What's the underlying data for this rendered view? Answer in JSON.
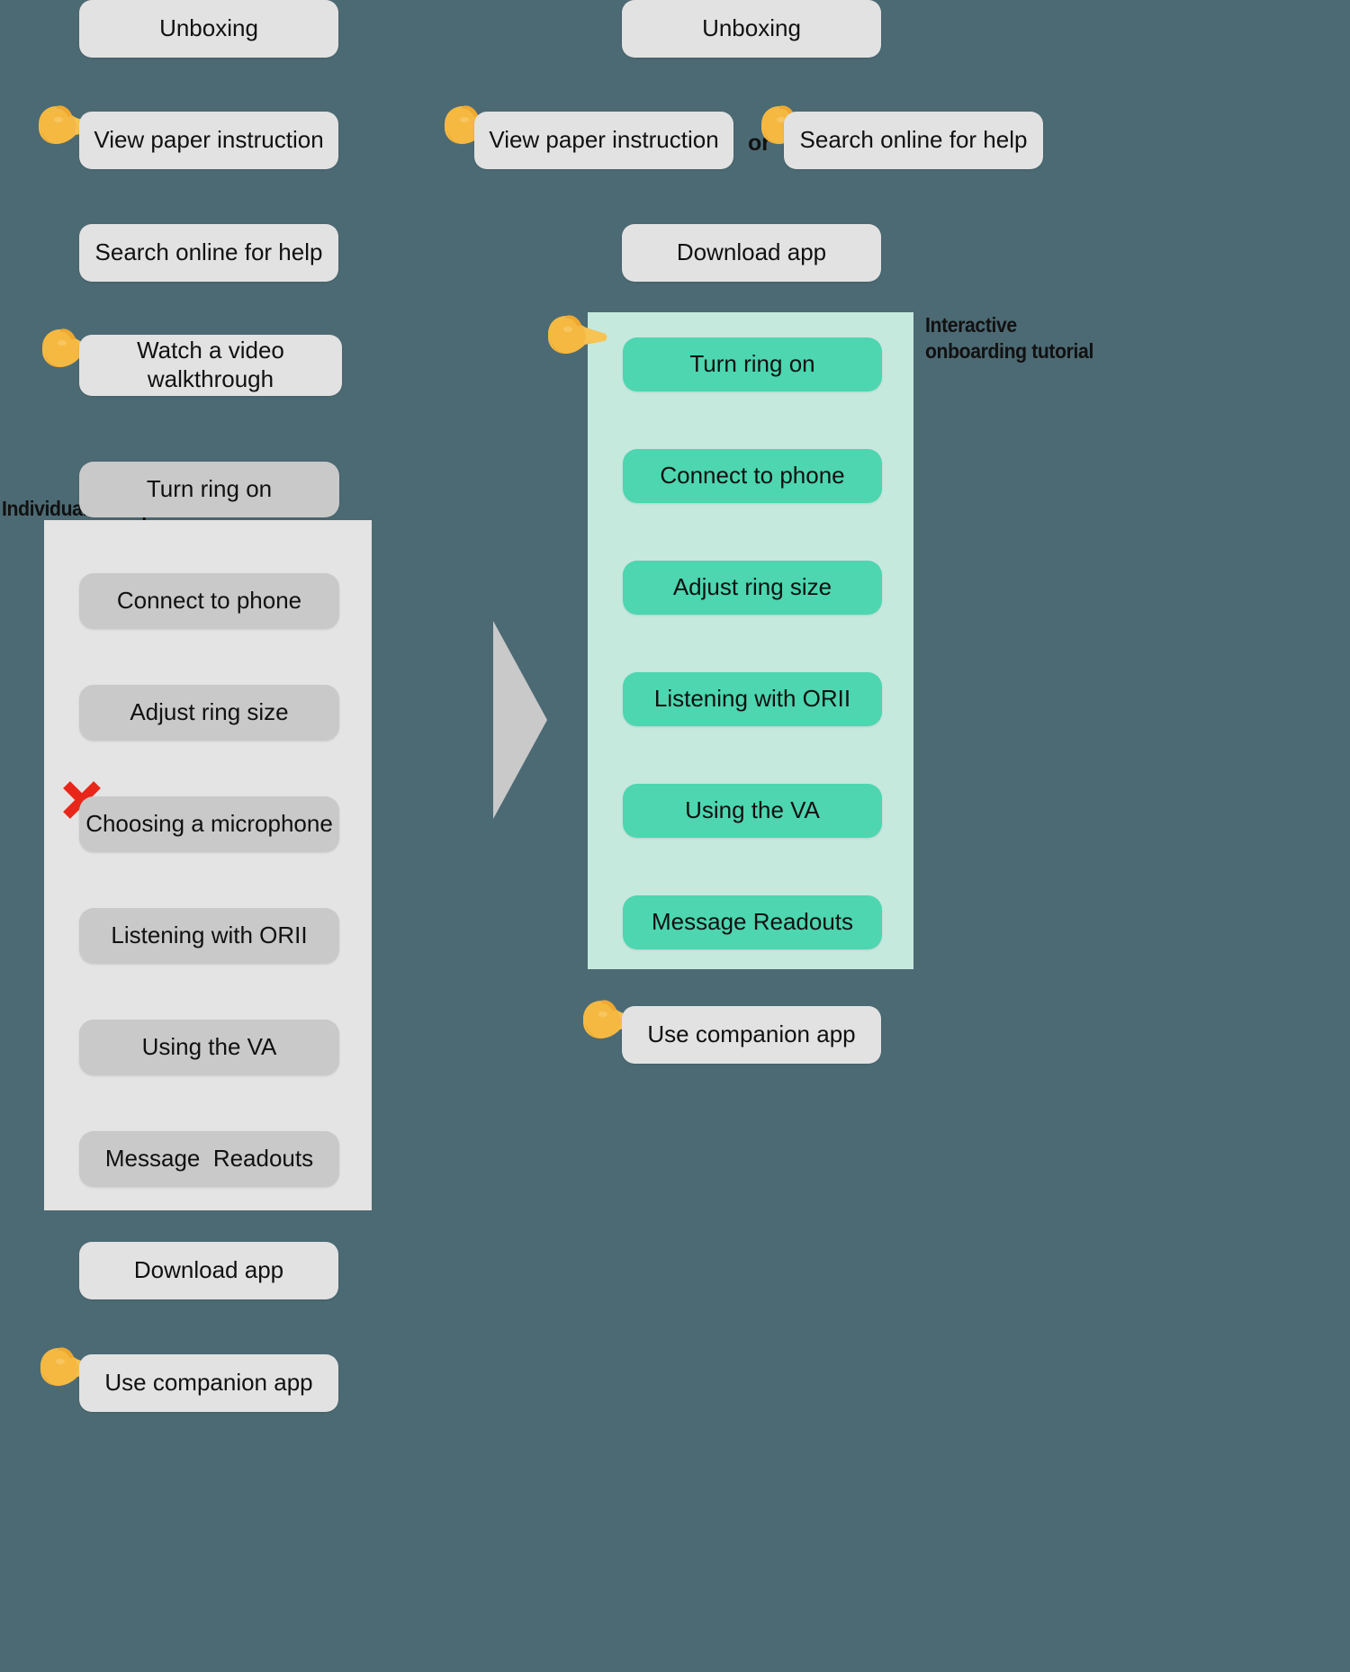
{
  "theme": {
    "background_color": "#4c6a73",
    "pill_color": "#e2e2e2",
    "grey_panel_color": "#e4e4e4",
    "grey_step_color": "#c9c9c9",
    "mint_panel_color": "#c6e9de",
    "mint_step_color": "#4dd6b0",
    "arrow_color": "#c9c9c9",
    "x_mark_color": "#e8271a",
    "text_color": "#111111"
  },
  "left_column": {
    "annotation": "Individual attempt",
    "steps_before": [
      {
        "label": "Unboxing",
        "has_hand": false
      },
      {
        "label": "View paper instruction",
        "has_hand": true
      },
      {
        "label": "Search online for help",
        "has_hand": false
      },
      {
        "label": "Watch a video\nwalkthrough",
        "has_hand": true
      }
    ],
    "panel_steps": [
      {
        "label": "Turn ring on",
        "failed": false
      },
      {
        "label": "Connect to phone",
        "failed": false
      },
      {
        "label": "Adjust ring size",
        "failed": false
      },
      {
        "label": "Choosing a microphone",
        "failed": true
      },
      {
        "label": "Listening with ORII",
        "failed": false
      },
      {
        "label": "Using the VA",
        "failed": false
      },
      {
        "label": "Message  Readouts",
        "failed": false
      }
    ],
    "steps_after": [
      {
        "label": "Download app",
        "has_hand": false
      },
      {
        "label": "Use companion app",
        "has_hand": true
      }
    ]
  },
  "right_column": {
    "annotation": "Interactive\nonboarding tutorial",
    "or_label": "or",
    "steps_before": [
      {
        "label": "Unboxing",
        "has_hand": false
      },
      {
        "label": "View paper instruction",
        "has_hand": true
      },
      {
        "label": "Search online for help",
        "has_hand": true
      },
      {
        "label": "Download app",
        "has_hand": false
      }
    ],
    "panel_steps": [
      {
        "label": "Turn ring on"
      },
      {
        "label": "Connect to phone"
      },
      {
        "label": "Adjust ring size"
      },
      {
        "label": "Listening with ORII"
      },
      {
        "label": "Using the VA"
      },
      {
        "label": "Message Readouts"
      }
    ],
    "steps_after": [
      {
        "label": "Use companion app",
        "has_hand": true
      }
    ]
  },
  "icons": {
    "hand": "pointing-hand-left-icon",
    "x": "red-x-icon",
    "arrow": "right-arrow-icon"
  }
}
